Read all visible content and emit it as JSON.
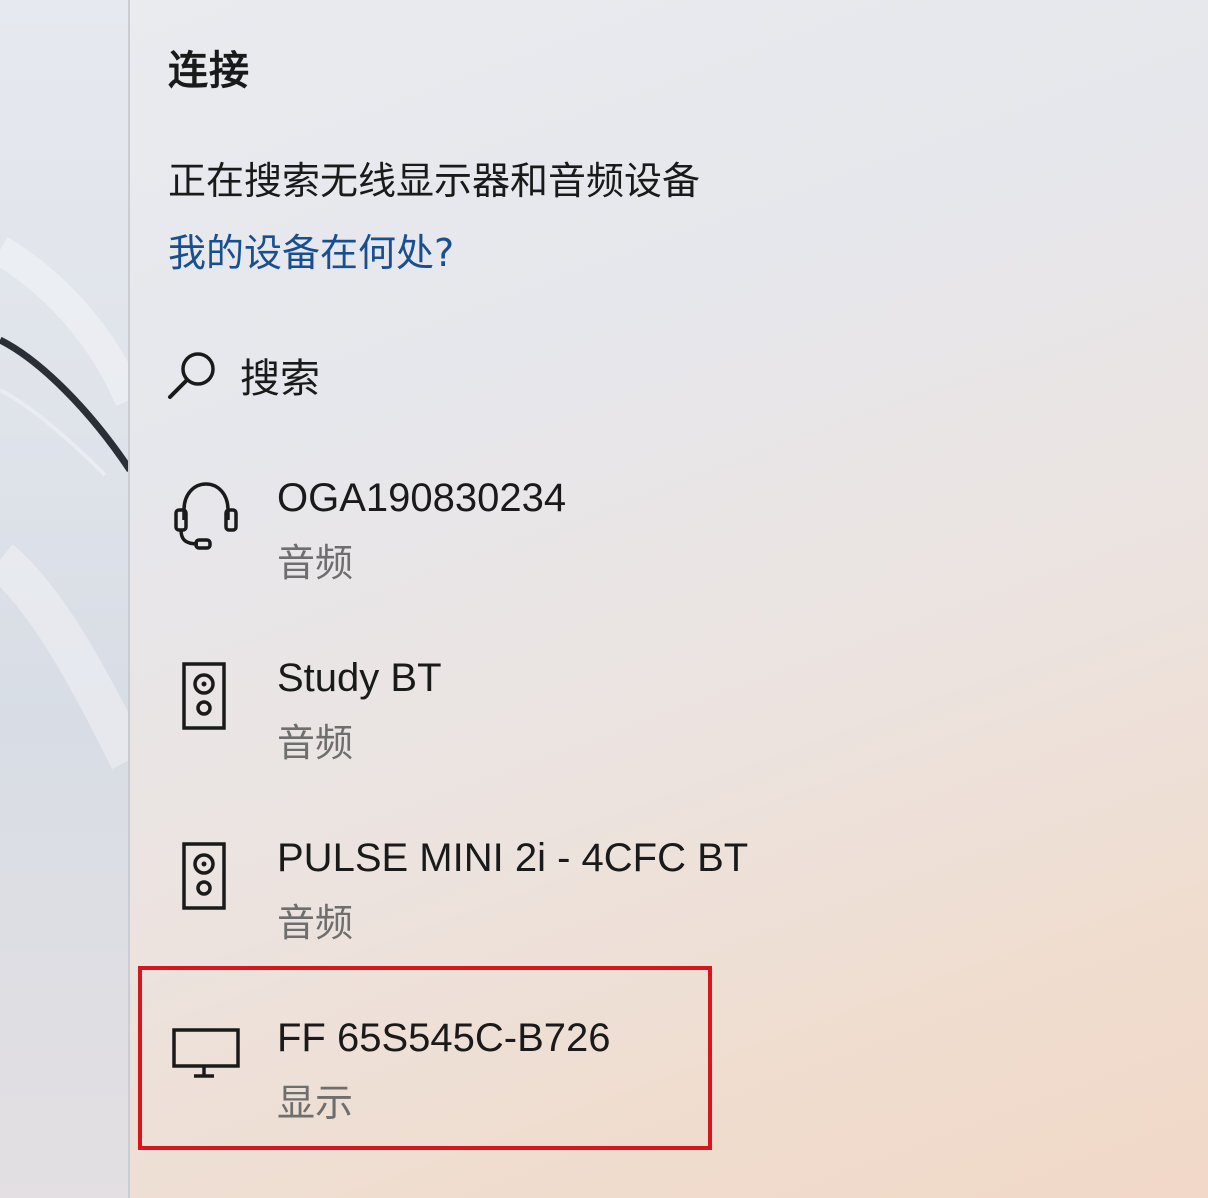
{
  "panel": {
    "title": "连接",
    "status": "正在搜索无线显示器和音频设备",
    "help_link": "我的设备在何处?",
    "search_label": "搜索"
  },
  "devices": [
    {
      "name": "OGA190830234",
      "type": "音频",
      "icon": "headset-icon"
    },
    {
      "name": "Study BT",
      "type": "音频",
      "icon": "speaker-icon"
    },
    {
      "name": "PULSE MINI 2i - 4CFC BT",
      "type": "音频",
      "icon": "speaker-icon"
    },
    {
      "name": "FF 65S545C-B726",
      "type": "显示",
      "icon": "monitor-icon"
    }
  ],
  "colors": {
    "link": "#1a4f8f",
    "highlight_border": "#d8141c"
  }
}
